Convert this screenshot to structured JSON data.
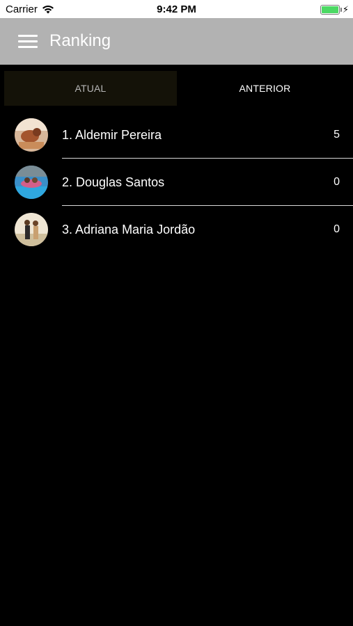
{
  "status_bar": {
    "carrier": "Carrier",
    "time": "9:42 PM",
    "battery_level": 1.0,
    "charging": true
  },
  "app_bar": {
    "title": "Ranking",
    "menu_icon": "hamburger-menu-icon",
    "background": "#b2b2b2"
  },
  "tabs": [
    {
      "label": "ATUAL",
      "selected": false
    },
    {
      "label": "ANTERIOR",
      "selected": true
    }
  ],
  "ranking": [
    {
      "name": "1. Aldemir Pereira",
      "score": "5"
    },
    {
      "name": "2. Douglas Santos",
      "score": "0"
    },
    {
      "name": "3. Adriana Maria Jordão",
      "score": "0"
    }
  ],
  "colors": {
    "background": "#000000",
    "text": "#ffffff",
    "battery": "#4cd964"
  }
}
